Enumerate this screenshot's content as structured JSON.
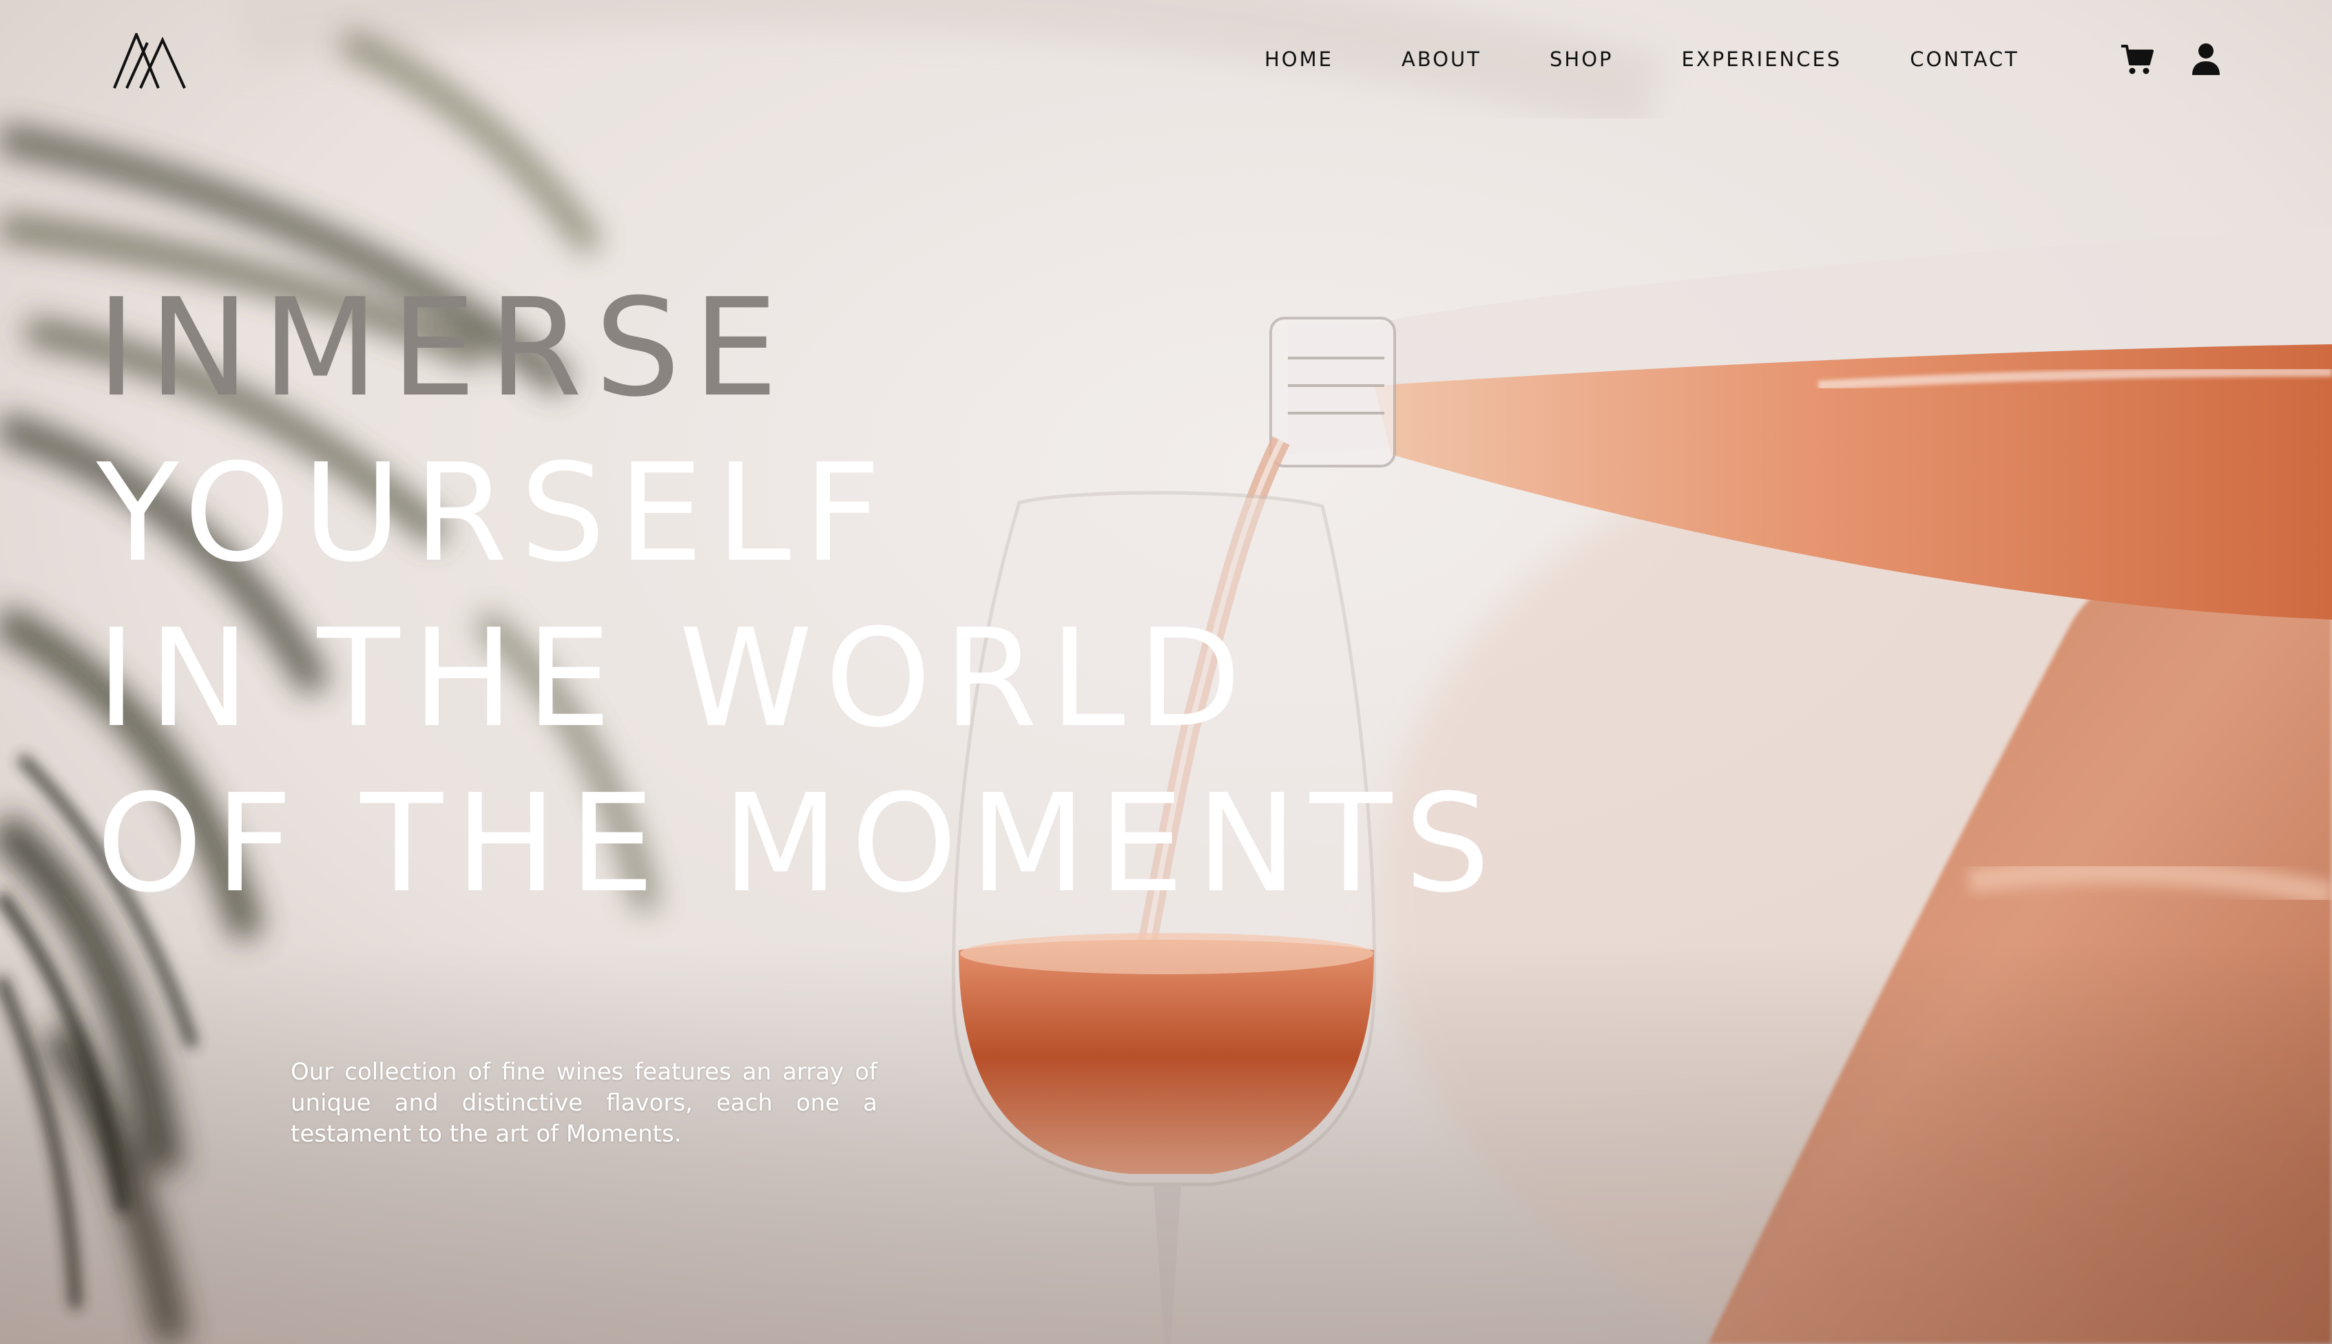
{
  "brand": {
    "logo_icon": "double-peak-logo-icon"
  },
  "nav": {
    "items": [
      {
        "label": "HOME"
      },
      {
        "label": "ABOUT"
      },
      {
        "label": "SHOP"
      },
      {
        "label": "EXPERIENCES"
      },
      {
        "label": "CONTACT"
      }
    ]
  },
  "header_icons": {
    "cart": "cart-icon",
    "account": "user-icon"
  },
  "hero": {
    "headline_lines": [
      "INMERSE",
      "YOURSELF",
      "IN THE WORLD",
      "OF THE MOMENTS"
    ],
    "intro": "Our collection of fine wines features an array of unique and distinctive flavors, each one a testament to the art of Moments."
  },
  "colors": {
    "nav_text": "#111111",
    "headline": "#ffffff",
    "headline_first_line": "#8a8480",
    "background": "#ece6e2",
    "wine": "#d9714a"
  }
}
